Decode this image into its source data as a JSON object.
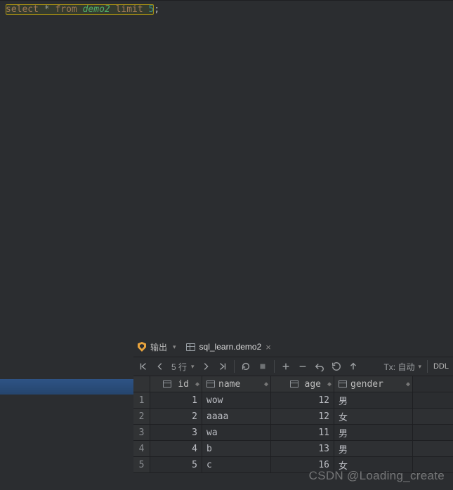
{
  "sql": {
    "kw_select": "select",
    "star": "*",
    "kw_from": "from",
    "table": "demo2",
    "kw_limit": "limit",
    "num": "5",
    "semi": ";"
  },
  "tabs": {
    "output_label": "输出",
    "data_tab_label": "sql_learn.demo2"
  },
  "toolbar": {
    "row_count_label": "5 行",
    "tx_label": "Tx: 自动",
    "ddl_label": "DDL"
  },
  "columns": {
    "id": "id",
    "name": "name",
    "age": "age",
    "gender": "gender"
  },
  "rows": [
    {
      "n": "1",
      "id": "1",
      "name": "wow",
      "age": "12",
      "gender": "男"
    },
    {
      "n": "2",
      "id": "2",
      "name": "aaaa",
      "age": "12",
      "gender": "女"
    },
    {
      "n": "3",
      "id": "3",
      "name": "wa",
      "age": "11",
      "gender": "男"
    },
    {
      "n": "4",
      "id": "4",
      "name": "b",
      "age": "13",
      "gender": "男"
    },
    {
      "n": "5",
      "id": "5",
      "name": "c",
      "age": "16",
      "gender": "女"
    }
  ],
  "watermark": "CSDN @Loading_create"
}
